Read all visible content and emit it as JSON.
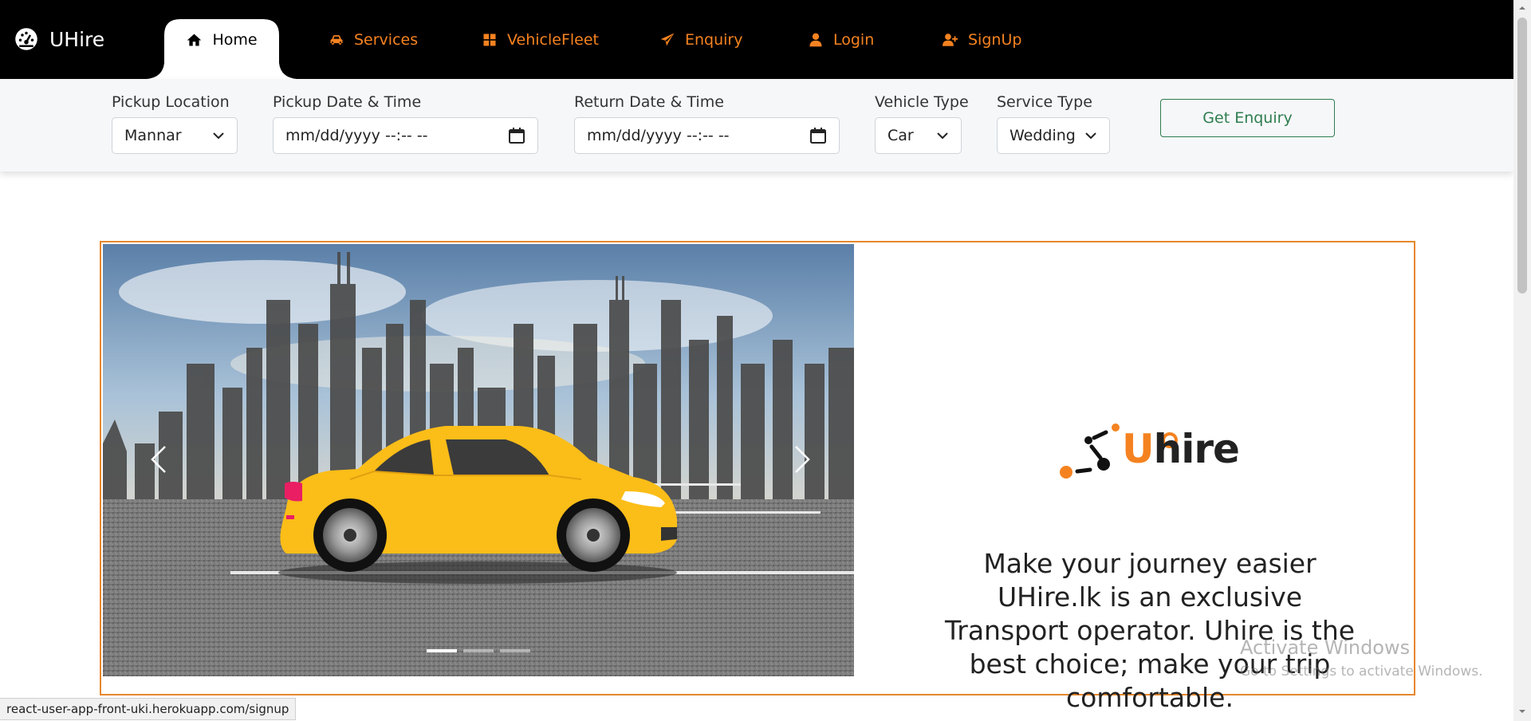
{
  "nav": {
    "brand": "UHire",
    "items": [
      {
        "label": "Home",
        "icon": "home-icon"
      },
      {
        "label": "Services",
        "icon": "car-icon"
      },
      {
        "label": "VehicleFleet",
        "icon": "grid-icon"
      },
      {
        "label": "Enquiry",
        "icon": "paper-plane-icon"
      },
      {
        "label": "Login",
        "icon": "user-icon"
      },
      {
        "label": "SignUp",
        "icon": "user-plus-icon"
      }
    ]
  },
  "filters": {
    "pickup_location": {
      "label": "Pickup Location",
      "value": "Mannar"
    },
    "pickup_datetime": {
      "label": "Pickup Date & Time",
      "placeholder": "mm/dd/yyyy --:-- --"
    },
    "return_datetime": {
      "label": "Return Date & Time",
      "placeholder": "mm/dd/yyyy --:-- --"
    },
    "vehicle_type": {
      "label": "Vehicle Type",
      "value": "Car"
    },
    "service_type": {
      "label": "Service Type",
      "value": "Wedding"
    },
    "enquiry_button": "Get Enquiry"
  },
  "hero": {
    "logo_text_u": "U",
    "logo_text_rest": "hire",
    "tagline": "Make your journey easier UHire.lk is an exclusive Transport operator. Uhire is the best choice; make your trip comfortable.",
    "slides": 3,
    "active_slide": 1
  },
  "watermark": {
    "line1": "Activate Windows",
    "line2": "Go to Settings to activate Windows."
  },
  "status_url": "react-user-app-front-uki.herokuapp.com/signup",
  "colors": {
    "accent": "#f58220",
    "navbar": "#000000",
    "hero_border": "#e6872d",
    "button_green": "#2e7d4f"
  }
}
